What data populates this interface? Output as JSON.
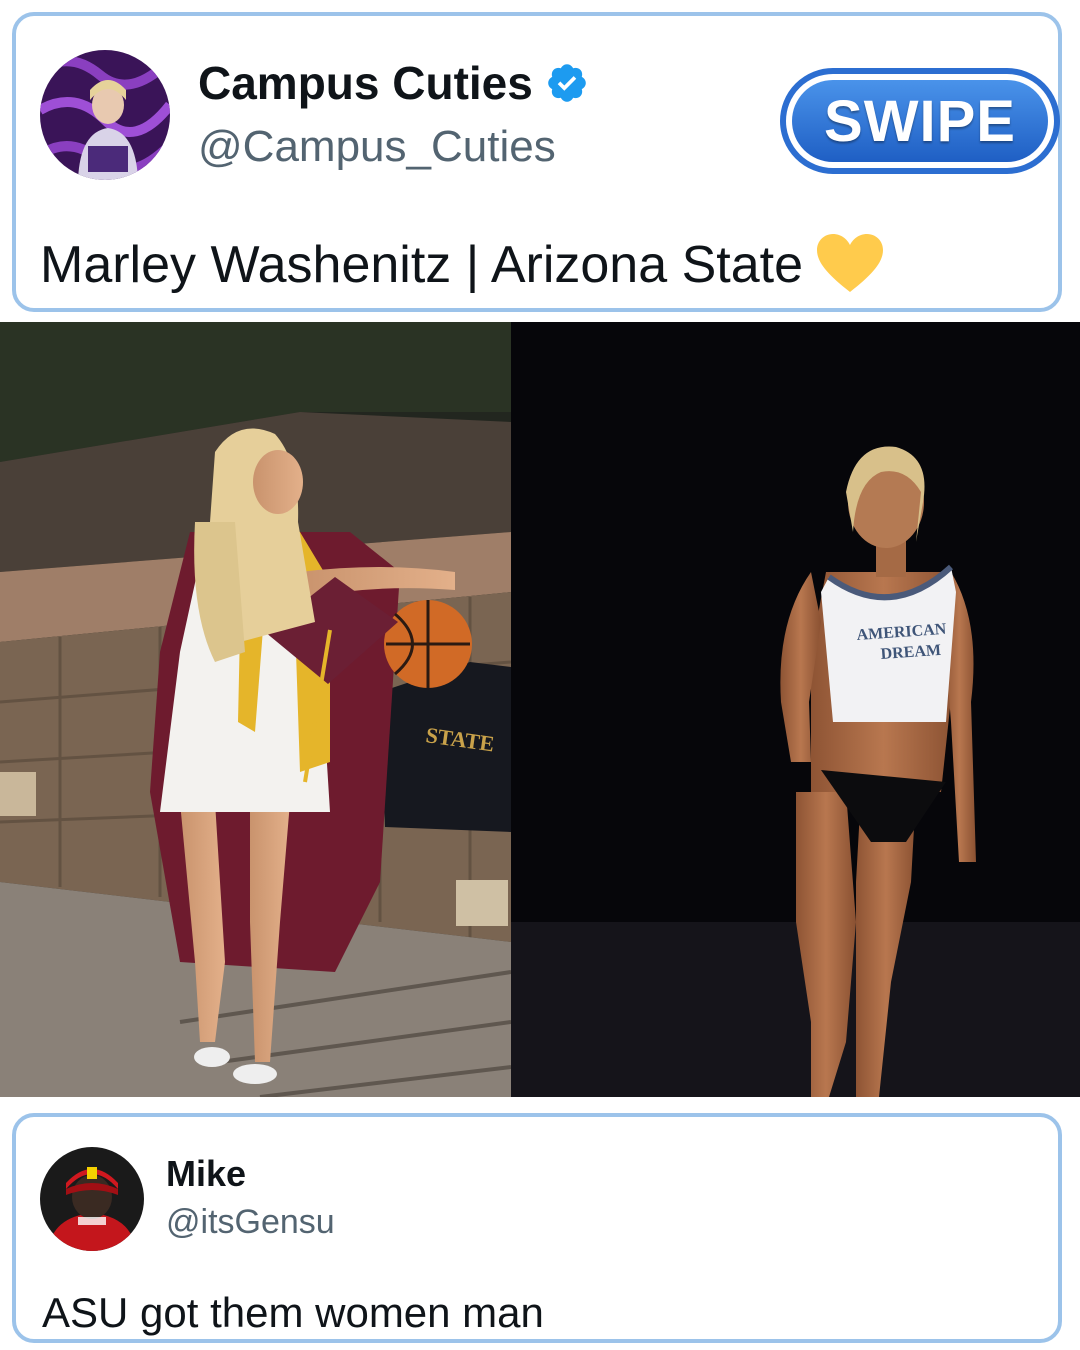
{
  "post": {
    "author": {
      "name": "Campus Cuties",
      "handle": "@Campus_Cuties",
      "verified": true,
      "avatar_icon": "profile-photo-avatar"
    },
    "text": "Marley Washenitz | Arizona State",
    "emoji_icon": "yellow-heart-icon",
    "swipe_label": "SWIPE",
    "photos": [
      {
        "icon": "graduation-photo",
        "jersey_text": "STATE"
      },
      {
        "icon": "night-beach-photo",
        "shirt_text_line1": "AMERICAN",
        "shirt_text_line2": "DREAM"
      }
    ]
  },
  "reply": {
    "author": {
      "name": "Mike",
      "handle": "@itsGensu",
      "avatar_icon": "profile-photo-avatar"
    },
    "text": "ASU got them women man"
  },
  "colors": {
    "card_border": "#9cc3ea",
    "verified_blue": "#1d9bf0",
    "swipe_blue": "#2c6ed1",
    "heart_yellow": "#ffcb4c"
  }
}
